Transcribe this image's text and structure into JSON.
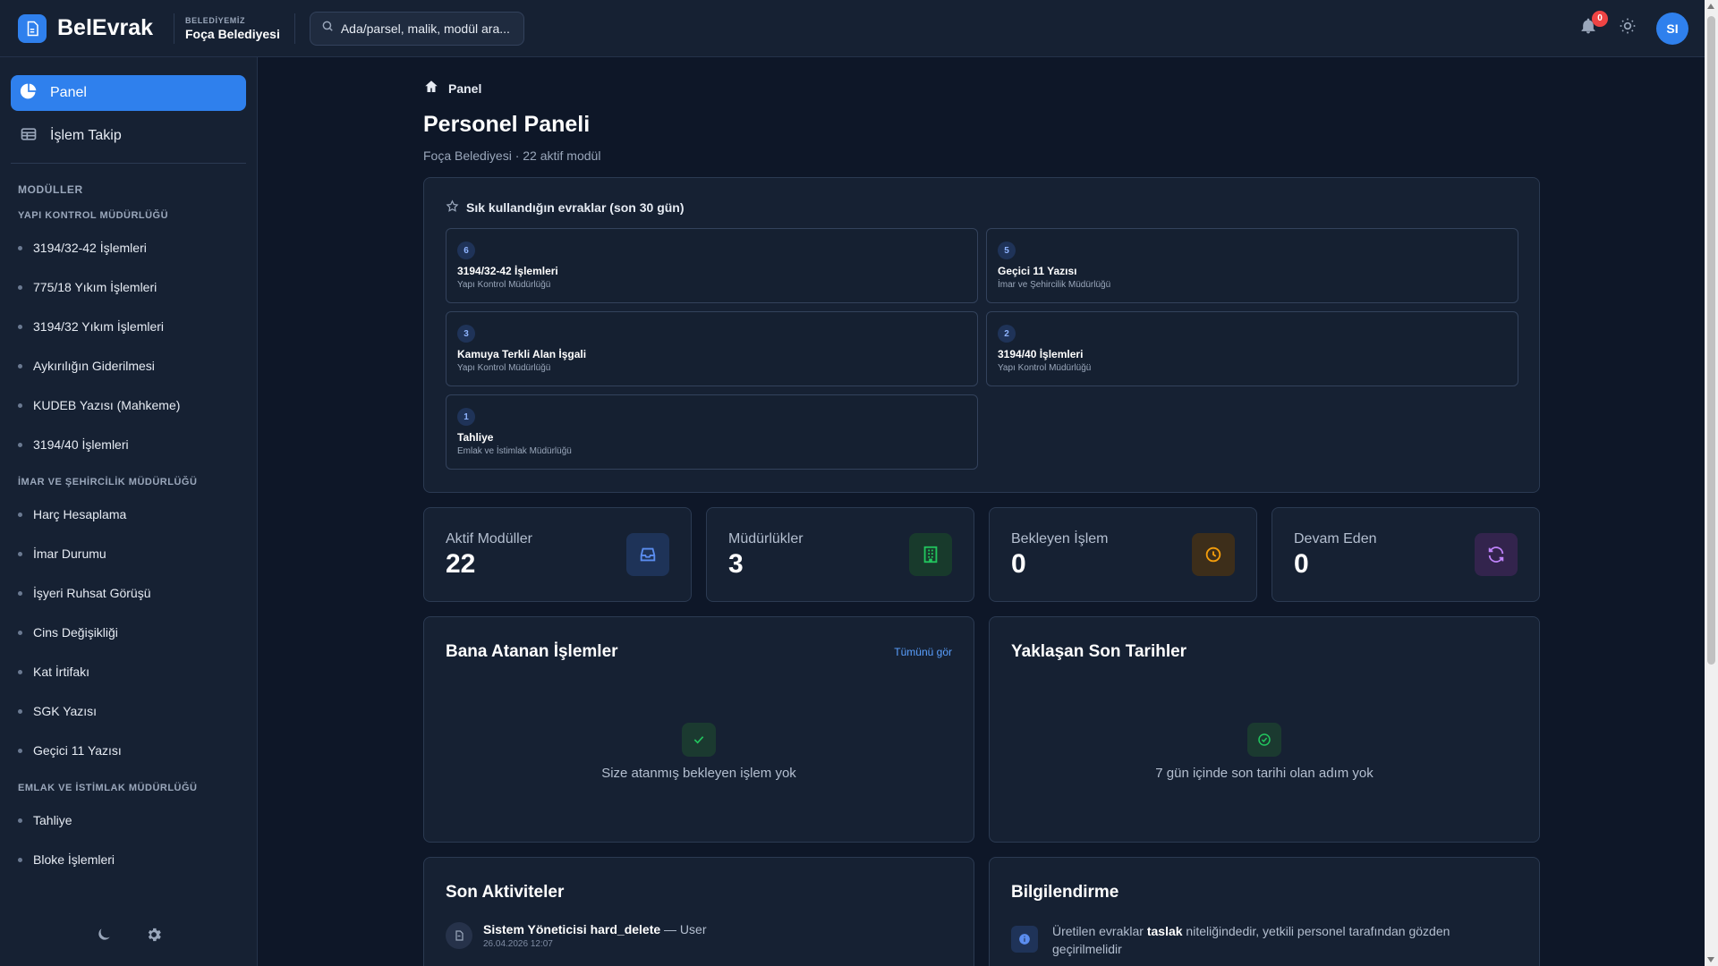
{
  "header": {
    "app_name": "BelEvrak",
    "org_small": "BELEDİYEMİZ",
    "org_name": "Foça Belediyesi",
    "search_placeholder": "Ada/parsel, malik, modül ara...",
    "notification_count": "0",
    "avatar_initials": "SI"
  },
  "sidebar": {
    "nav": [
      {
        "label": "Panel",
        "icon": "pie-chart-icon",
        "active": true
      },
      {
        "label": "İşlem Takip",
        "icon": "table-icon",
        "active": false
      }
    ],
    "modules_heading": "MODÜLLER",
    "groups": [
      {
        "title": "YAPI KONTROL MÜDÜRLÜĞÜ",
        "items": [
          "3194/32-42 İşlemleri",
          "775/18 Yıkım İşlemleri",
          "3194/32 Yıkım İşlemleri",
          "Aykırılığın Giderilmesi",
          "KUDEB Yazısı (Mahkeme)",
          "3194/40 İşlemleri"
        ]
      },
      {
        "title": "İMAR VE ŞEHİRCİLİK MÜDÜRLÜĞÜ",
        "items": [
          "Harç Hesaplama",
          "İmar Durumu",
          "İşyeri Ruhsat Görüşü",
          "Cins Değişikliği",
          "Kat İrtifakı",
          "SGK Yazısı",
          "Geçici 11 Yazısı"
        ]
      },
      {
        "title": "EMLAK VE İSTİMLAK MÜDÜRLÜĞÜ",
        "items": [
          "Tahliye",
          "Bloke İşlemleri"
        ]
      }
    ],
    "bottom_icons": [
      "moon-icon",
      "gear-icon"
    ]
  },
  "main": {
    "breadcrumb": "Panel",
    "title": "Personel Paneli",
    "subtitle": "Foça Belediyesi · 22 aktif modül",
    "favorites": {
      "heading": "Sık kullandığın evraklar (son 30 gün)",
      "items": [
        {
          "count": "6",
          "title": "3194/32-42 İşlemleri",
          "dept": "Yapı Kontrol Müdürlüğü"
        },
        {
          "count": "5",
          "title": "Geçici 11 Yazısı",
          "dept": "İmar ve Şehircilik Müdürlüğü"
        },
        {
          "count": "3",
          "title": "Kamuya Terkli Alan İşgali",
          "dept": "Yapı Kontrol Müdürlüğü"
        },
        {
          "count": "2",
          "title": "3194/40 İşlemleri",
          "dept": "Yapı Kontrol Müdürlüğü"
        },
        {
          "count": "1",
          "title": "Tahliye",
          "dept": "Emlak ve İstimlak Müdürlüğü"
        }
      ]
    },
    "stats": [
      {
        "label": "Aktif Modüller",
        "value": "22",
        "icon": "inbox-icon",
        "color": "#5b8def",
        "bg": "#1e3358"
      },
      {
        "label": "Müdürlükler",
        "value": "3",
        "icon": "building-icon",
        "color": "#22c55e",
        "bg": "#183a2c"
      },
      {
        "label": "Bekleyen İşlem",
        "value": "0",
        "icon": "clock-icon",
        "color": "#f59e0b",
        "bg": "#3d2e1a"
      },
      {
        "label": "Devam Eden",
        "value": "0",
        "icon": "refresh-icon",
        "color": "#c084fc",
        "bg": "#33244d"
      }
    ],
    "assigned": {
      "title": "Bana Atanan İşlemler",
      "link": "Tümünü gör",
      "empty_text": "Size atanmış bekleyen işlem yok"
    },
    "deadlines": {
      "title": "Yaklaşan Son Tarihler",
      "empty_text": "7 gün içinde son tarihi olan adım yok"
    },
    "activities": {
      "title": "Son Aktiviteler",
      "items": [
        {
          "actor": "Sistem Yöneticisi hard_delete",
          "rest": " — User",
          "date": "26.04.2026 12:07"
        }
      ]
    },
    "notice": {
      "title": "Bilgilendirme",
      "text_before": "Üretilen evraklar ",
      "text_bold": "taslak",
      "text_after": " niteliğindedir, yetkili personel tarafından gözden geçirilmelidir"
    }
  },
  "colors": {
    "accent": "#2f80ed",
    "background": "#0e1728",
    "surface": "#162133",
    "badge": "#ef4444"
  }
}
